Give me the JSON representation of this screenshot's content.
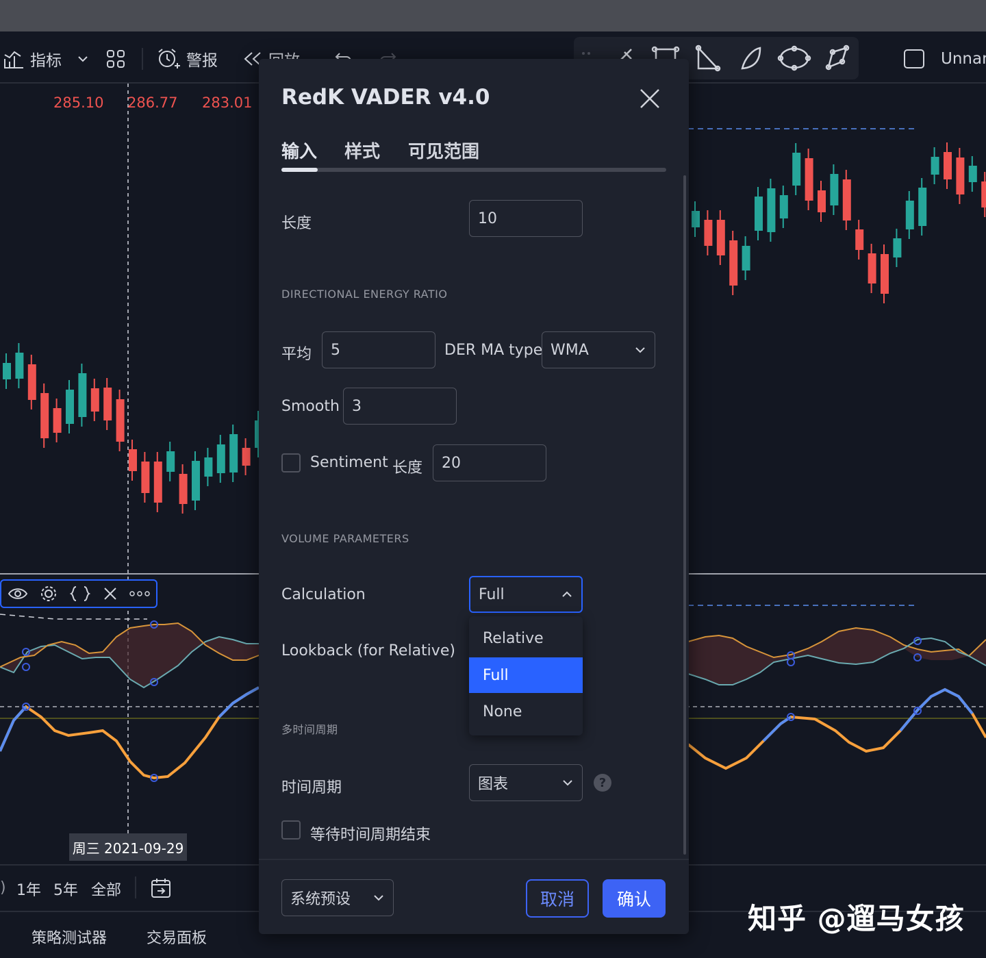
{
  "toolbar": {
    "indicators_label": "指标",
    "alert_label": "警报",
    "replay_label": "回放",
    "layout_name": "Unnam"
  },
  "chart": {
    "prices": [
      "285.10",
      "286.77",
      "283.01"
    ],
    "date_label": "周三 2021-09-29"
  },
  "bottom_bar": {
    "ranges": [
      "1年",
      "5年",
      "全部"
    ]
  },
  "bottom_tabs": {
    "strategy_tester": "策略测试器",
    "trading_panel": "交易面板"
  },
  "watermark": "知乎 @遛马女孩",
  "dialog": {
    "title": "RedK VADER v4.0",
    "tabs": [
      {
        "label": "输入",
        "active": true
      },
      {
        "label": "样式",
        "active": false
      },
      {
        "label": "可见范围",
        "active": false
      }
    ],
    "length_label": "长度",
    "length_value": "10",
    "section_der": "DIRECTIONAL ENERGY RATIO",
    "avg_label": "平均",
    "avg_value": "5",
    "der_ma_type_label": "DER MA type",
    "der_ma_type_value": "WMA",
    "smooth_label": "Smooth",
    "smooth_value": "3",
    "sentiment_label": "Sentiment",
    "sentiment_checked": false,
    "sentiment_length_label": "长度",
    "sentiment_length_value": "20",
    "section_volume": "VOLUME PARAMETERS",
    "calculation_label": "Calculation",
    "calculation_value": "Full",
    "calculation_options": [
      "Relative",
      "Full",
      "None"
    ],
    "lookback_label": "Lookback (for Relative)",
    "section_mtf": "多时间周期",
    "timeframe_label": "时间周期",
    "timeframe_value": "图表",
    "wait_close_label": "等待时间周期结束",
    "wait_close_checked": false,
    "footer": {
      "defaults_label": "系统预设",
      "cancel_label": "取消",
      "ok_label": "确认"
    }
  },
  "colors": {
    "background": "#131722",
    "panel": "#1e222d",
    "accent": "#2962ff",
    "ok_button": "#3d63f5",
    "candle_up": "#26a69a",
    "candle_down": "#ef5350",
    "line_orange": "#f7a03c",
    "line_blue": "#5b8def"
  }
}
